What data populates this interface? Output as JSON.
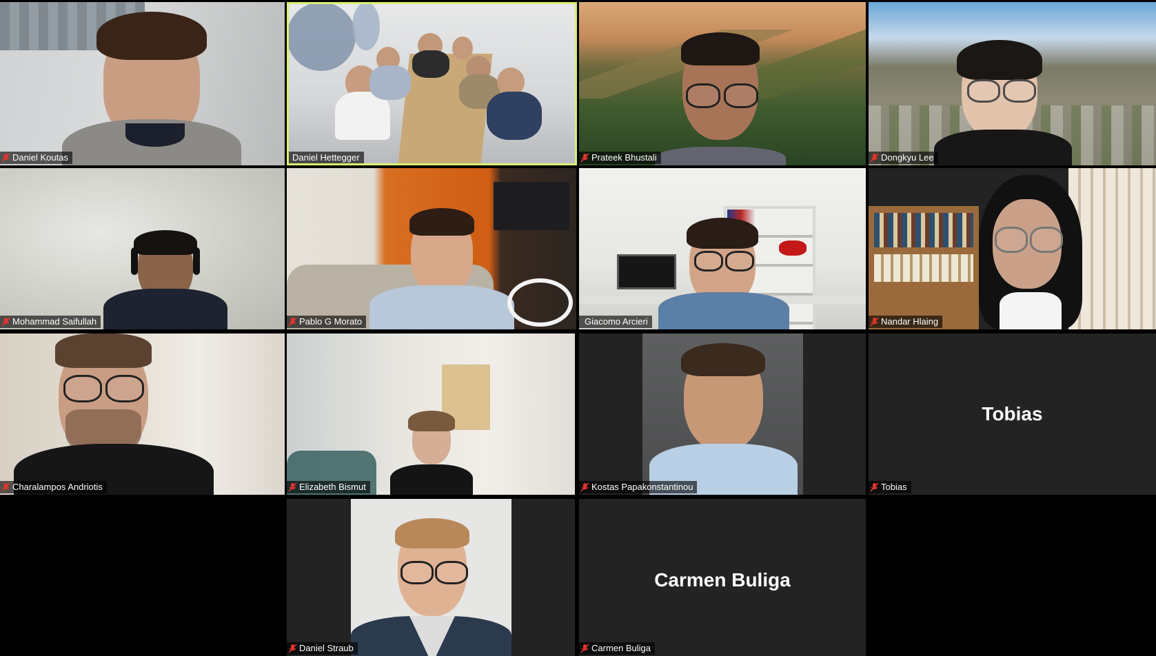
{
  "meeting": {
    "participants": [
      {
        "name": "Daniel Koutas",
        "muted": true,
        "video": true
      },
      {
        "name": "Daniel Hettegger",
        "muted": false,
        "video": true,
        "active_speaker": true
      },
      {
        "name": "Prateek Bhustali",
        "muted": true,
        "video": true
      },
      {
        "name": "Dongkyu Lee",
        "muted": true,
        "video": true
      },
      {
        "name": "Mohammad Saifullah",
        "muted": true,
        "video": true
      },
      {
        "name": "Pablo G Morato",
        "muted": true,
        "video": true
      },
      {
        "name": "Giacomo Arcieri",
        "muted": false,
        "video": true
      },
      {
        "name": "Nandar Hlaing",
        "muted": true,
        "video": true
      },
      {
        "name": "Charalampos Andriotis",
        "muted": true,
        "video": true
      },
      {
        "name": "Elizabeth Bismut",
        "muted": true,
        "video": true
      },
      {
        "name": "Kostas Papakonstantinou",
        "muted": true,
        "video": true,
        "profile_photo": true
      },
      {
        "name": "Tobias",
        "muted": true,
        "video": false,
        "display_name": "Tobias"
      },
      {
        "name": "Daniel Straub",
        "muted": true,
        "video": true,
        "profile_photo": true
      },
      {
        "name": "Carmen Buliga",
        "muted": true,
        "video": false,
        "display_name": "Carmen Buliga"
      }
    ]
  },
  "icons": {
    "muted": "mic-muted-icon"
  },
  "colors": {
    "tile_background": "#232323",
    "active_speaker_border": "#d8ef72",
    "muted_icon": "#e0342c",
    "nameplate_text": "#ffffff"
  }
}
